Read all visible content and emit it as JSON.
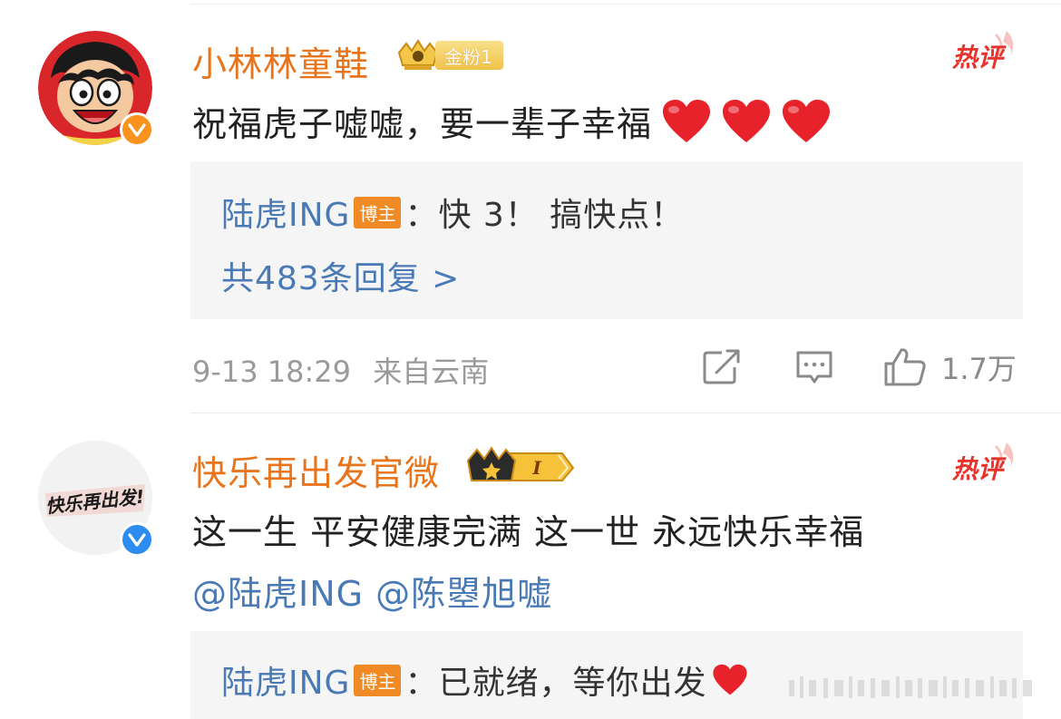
{
  "comments": [
    {
      "username": "小林林童鞋",
      "badge_label": "金粉1",
      "hot_label": "热评",
      "text": "祝福虎子嘘嘘，要一辈子幸福",
      "reply": {
        "author": "陆虎ING",
        "role_tag": "博主",
        "text": "：快 3！ 搞快点！"
      },
      "reply_count_label": "共483条回复 >",
      "timestamp": "9-13 18:29",
      "location": "来自云南",
      "like_count": "1.7万"
    },
    {
      "username": "快乐再出发官微",
      "badge_label": "I",
      "hot_label": "热评",
      "text": "这一生 平安健康完满 这一世 永远快乐幸福",
      "mentions": "@陆虎ING @陈曌旭嘘",
      "avatar_text": "快乐再出发!",
      "reply": {
        "author": "陆虎ING",
        "role_tag": "博主",
        "text": "：已就绪，等你出发"
      }
    }
  ],
  "colors": {
    "username": "#e8741c",
    "link": "#4a7ab5",
    "hot": "#e8322c",
    "meta": "#9a9a9a",
    "reply_bg": "#f5f5f5"
  },
  "icons": [
    "verified-badge-icon",
    "crown-icon",
    "hot-comment-icon",
    "heart-icon",
    "share-icon",
    "comment-icon",
    "like-icon"
  ]
}
